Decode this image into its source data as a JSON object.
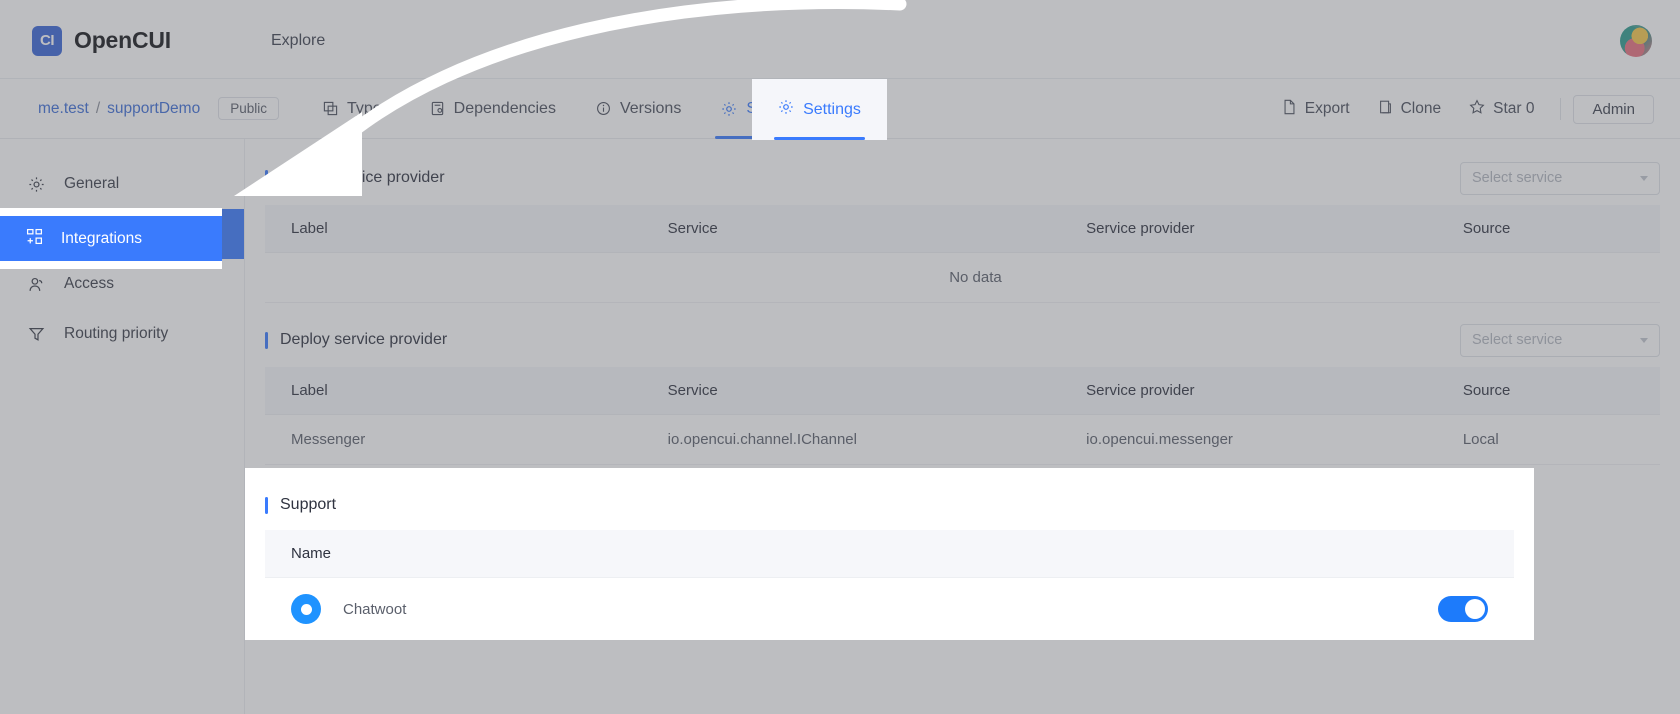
{
  "header": {
    "logo_text": "CI",
    "brand": "OpenCUI",
    "explore": "Explore",
    "avatar_name": "user-avatar"
  },
  "breadcrumb": {
    "owner": "me.test",
    "separator": "/",
    "project": "supportDemo",
    "visibility": "Public"
  },
  "tabs": [
    {
      "label": "Types",
      "icon": "types-icon",
      "active": false
    },
    {
      "label": "Dependencies",
      "icon": "dependencies-icon",
      "active": false
    },
    {
      "label": "Versions",
      "icon": "versions-icon",
      "active": false
    },
    {
      "label": "Settings",
      "icon": "gear-icon",
      "active": true
    }
  ],
  "actions": {
    "export": "Export",
    "clone": "Clone",
    "star": "Star 0",
    "admin": "Admin"
  },
  "sidebar": {
    "items": [
      {
        "label": "General",
        "icon": "gear-icon",
        "active": false
      },
      {
        "label": "Integrations",
        "icon": "integrations-grid-icon",
        "active": true
      },
      {
        "label": "Access",
        "icon": "person-icon",
        "active": false
      },
      {
        "label": "Routing priority",
        "icon": "funnel-icon",
        "active": false
      }
    ]
  },
  "sections": {
    "debug": {
      "title": "Debug service provider",
      "select_placeholder": "Select service",
      "columns": [
        "Label",
        "Service",
        "Service provider",
        "Source"
      ],
      "rows": [],
      "empty_text": "No data"
    },
    "deploy": {
      "title": "Deploy service provider",
      "select_placeholder": "Select service",
      "columns": [
        "Label",
        "Service",
        "Service provider",
        "Source"
      ],
      "rows": [
        {
          "label": "Messenger",
          "service": "io.opencui.channel.IChannel",
          "provider": "io.opencui.messenger",
          "source": "Local"
        }
      ]
    },
    "support": {
      "title": "Support",
      "columns": [
        "Name"
      ],
      "rows": [
        {
          "name": "Chatwoot",
          "icon": "chatwoot-logo-icon",
          "enabled": true
        }
      ]
    }
  },
  "colors": {
    "accent": "#3a7bfd",
    "link": "#3f6fd8",
    "toggle_on": "#1d7bfb",
    "chatwoot_blue": "#1f93ff",
    "scrim": "rgba(90,92,100,0.40)"
  },
  "annotation": {
    "arrow_name": "guide-arrow",
    "description": "white curved arrow from Settings tab to Integrations"
  }
}
